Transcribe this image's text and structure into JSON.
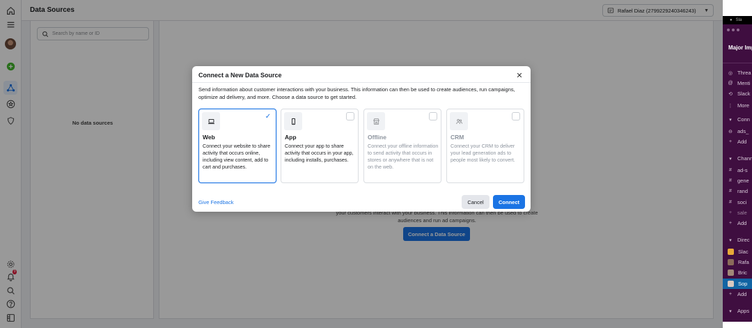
{
  "header": {
    "title": "Data Sources",
    "account": "Rafael Diaz (2799229240346243)"
  },
  "left_panel": {
    "search_placeholder": "Search by name or ID",
    "empty_text": "No data sources"
  },
  "main": {
    "description": "your customers interact with your business. This information can then be used to create audiences and run ad campaigns.",
    "cta_label": "Connect a Data Source"
  },
  "rail": {
    "notification_count": "9"
  },
  "modal": {
    "title": "Connect a New Data Source",
    "intro": "Send information about customer interactions with your business. This information can then be used to create audiences, run campaigns, optimize ad delivery, and more. Choose a data source to get started.",
    "cards": [
      {
        "name": "Web",
        "desc": "Connect your website to share activity that occurs online, including view content, add to cart and purchases.",
        "icon": "laptop-icon",
        "selected": true,
        "disabled": false
      },
      {
        "name": "App",
        "desc": "Connect your app to share activity that occurs in your app, including installs, purchases.",
        "icon": "phone-icon",
        "selected": false,
        "disabled": false
      },
      {
        "name": "Offline",
        "desc": "Connect your offline information to send activity that occurs in stores or anywhere that is not on the web.",
        "icon": "store-icon",
        "selected": false,
        "disabled": true
      },
      {
        "name": "CRM",
        "desc": "Connect your CRM to deliver your lead generation ads to people most likely to convert.",
        "icon": "people-icon",
        "selected": false,
        "disabled": true
      }
    ],
    "feedback_label": "Give Feedback",
    "cancel_label": "Cancel",
    "connect_label": "Connect",
    "colors": {
      "accent": "#1b74e4",
      "disabled_text": "#8d949e"
    }
  },
  "slack": {
    "title_partial": "Sla",
    "workspace": "Major Imp",
    "nav": [
      "Threa",
      "Menti",
      "Slack",
      "More"
    ],
    "sections": {
      "connections": "Conn",
      "channels": "Chann",
      "direct": "Direc",
      "apps": "Apps"
    },
    "connection_items": [
      "ads_"
    ],
    "channels": [
      "ad-s",
      "gene",
      "rand",
      "soci",
      "sale"
    ],
    "dms": [
      "Slac",
      "Rafa",
      "Bric",
      "Sop"
    ],
    "add_label": "Add"
  }
}
